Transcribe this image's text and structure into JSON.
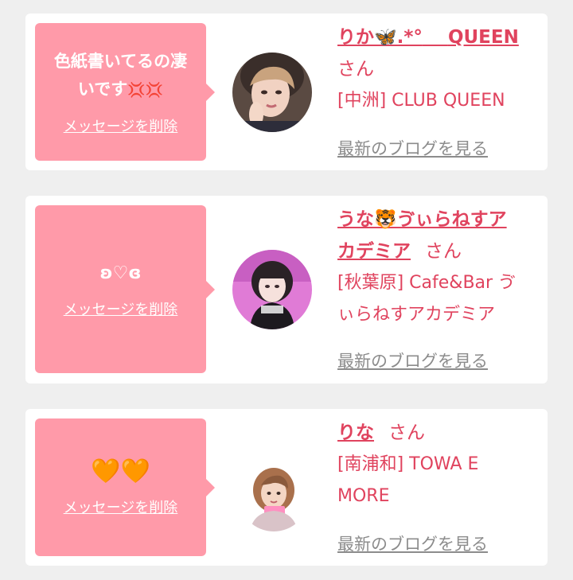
{
  "cards": [
    {
      "message_line1": "色紙書いてるの凄",
      "message_line2": "いです",
      "message_emoji": "💢💢",
      "delete_label": "メッセージを削除",
      "name_part1": "りか🦋.*°",
      "name_part2": "QUEEN",
      "honorific": "さん",
      "shop": "[中洲] CLUB QUEEN",
      "blog_label": "最新のブログを見る"
    },
    {
      "message": "ʚ♡ɞ",
      "delete_label": "メッセージを削除",
      "name_line1": "うな🐯ゔぃらねすア",
      "name_line2": "カデミア",
      "honorific": "さん",
      "shop_line1": "[秋葉原] Cafe&Bar ゔ",
      "shop_line2": "ぃらねすアカデミア",
      "blog_label": "最新のブログを見る"
    },
    {
      "message": "🧡🧡",
      "delete_label": "メッセージを削除",
      "name": "りな",
      "honorific": "さん",
      "shop_line1": "[南浦和] TOWA E",
      "shop_line2": "MORE",
      "blog_label": "最新のブログを見る"
    }
  ],
  "colors": {
    "bubble": "#ff9aa9",
    "name": "#e0435e",
    "link_gray": "#8c8c8c",
    "background": "#efefef"
  }
}
